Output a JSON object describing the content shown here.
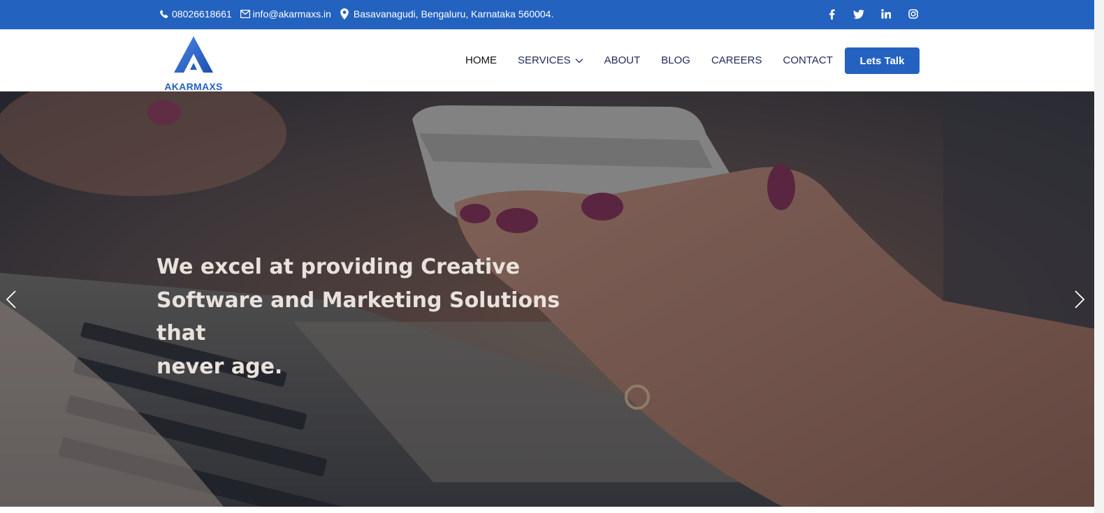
{
  "topbar": {
    "phone": "08026618661",
    "email": "info@akarmaxs.in",
    "address": "Basavanagudi, Bengaluru, Karnataka 560004.",
    "social_icons": [
      "facebook-icon",
      "twitter-icon",
      "linkedin-icon",
      "instagram-icon"
    ]
  },
  "brand": {
    "name": "AKARMAXS"
  },
  "nav": {
    "items": [
      {
        "label": "HOME",
        "active": true
      },
      {
        "label": "SERVICES",
        "dropdown": true
      },
      {
        "label": "ABOUT"
      },
      {
        "label": "BLOG"
      },
      {
        "label": "CAREERS"
      },
      {
        "label": "CONTACT"
      }
    ],
    "cta_label": "Lets Talk"
  },
  "hero": {
    "headline_lines": [
      "We excel at providing Creative",
      "Software and Marketing Solutions that",
      "never age."
    ],
    "prev_icon": "chevron-left-icon",
    "next_icon": "chevron-right-icon"
  },
  "colors": {
    "brand_blue": "#2462c0",
    "nav_text": "#1f2a5a",
    "hero_text": "#e9e2dc"
  }
}
